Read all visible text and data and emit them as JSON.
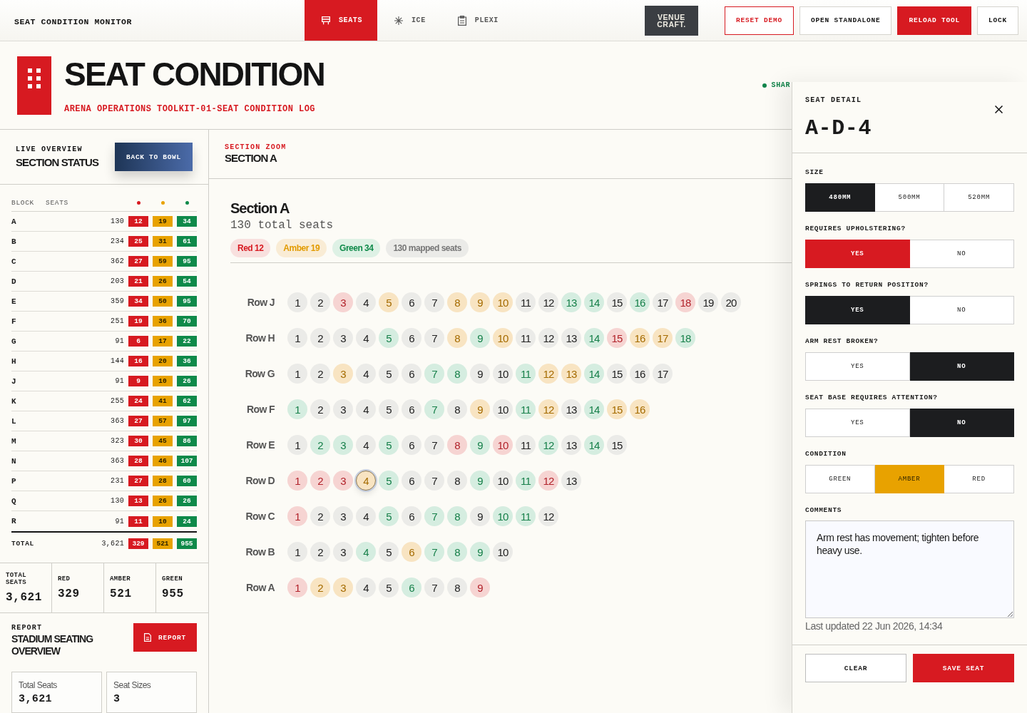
{
  "app": {
    "title": "SEAT CONDITION MONITOR"
  },
  "tabs": [
    {
      "label": "SEATS",
      "selected": true
    },
    {
      "label": "ICE",
      "selected": false
    },
    {
      "label": "PLEXI",
      "selected": false
    }
  ],
  "logo": {
    "lines": [
      "VENUE",
      "CRAFT."
    ]
  },
  "actions": [
    {
      "label": "RESET DEMO",
      "kind": "warning"
    },
    {
      "label": "OPEN STANDALONE",
      "kind": "plain"
    },
    {
      "label": "RELOAD TOOL",
      "kind": "primary"
    },
    {
      "label": "LOCK",
      "kind": "plain"
    }
  ],
  "header": {
    "title": "SEAT CONDITION",
    "subtitle": "ARENA OPERATIONS TOOLKIT-01-SEAT CONDITION LOG",
    "share_status": "SHAR"
  },
  "sidebar": {
    "overview": {
      "eyebrow": "LIVE OVERVIEW",
      "title": "SECTION STATUS",
      "button": "BACK TO BOWL"
    },
    "table": {
      "columns": [
        "BLOCK",
        "SEATS"
      ],
      "status_columns": [
        {
          "color": "#d71a21"
        },
        {
          "color": "#e8a200"
        },
        {
          "color": "#0f8a4a"
        }
      ],
      "rows": [
        {
          "block": "A",
          "seats": "130",
          "counts": [
            "12",
            "19",
            "34"
          ]
        },
        {
          "block": "B",
          "seats": "234",
          "counts": [
            "25",
            "31",
            "61"
          ]
        },
        {
          "block": "C",
          "seats": "362",
          "counts": [
            "27",
            "59",
            "95"
          ]
        },
        {
          "block": "D",
          "seats": "203",
          "counts": [
            "21",
            "26",
            "54"
          ]
        },
        {
          "block": "E",
          "seats": "359",
          "counts": [
            "34",
            "50",
            "95"
          ]
        },
        {
          "block": "F",
          "seats": "251",
          "counts": [
            "19",
            "36",
            "70"
          ]
        },
        {
          "block": "G",
          "seats": "91",
          "counts": [
            "6",
            "17",
            "22"
          ]
        },
        {
          "block": "H",
          "seats": "144",
          "counts": [
            "16",
            "20",
            "36"
          ]
        },
        {
          "block": "J",
          "seats": "91",
          "counts": [
            "9",
            "10",
            "26"
          ]
        },
        {
          "block": "K",
          "seats": "255",
          "counts": [
            "24",
            "41",
            "62"
          ]
        },
        {
          "block": "L",
          "seats": "363",
          "counts": [
            "27",
            "57",
            "97"
          ]
        },
        {
          "block": "M",
          "seats": "323",
          "counts": [
            "30",
            "45",
            "86"
          ]
        },
        {
          "block": "N",
          "seats": "363",
          "counts": [
            "28",
            "46",
            "107"
          ]
        },
        {
          "block": "P",
          "seats": "231",
          "counts": [
            "27",
            "28",
            "60"
          ]
        },
        {
          "block": "Q",
          "seats": "130",
          "counts": [
            "13",
            "26",
            "26"
          ]
        },
        {
          "block": "R",
          "seats": "91",
          "counts": [
            "11",
            "10",
            "24"
          ]
        }
      ],
      "total": {
        "label": "TOTAL",
        "seats": "3,621",
        "counts": [
          "329",
          "521",
          "955"
        ]
      }
    },
    "stats": [
      {
        "label": "TOTAL SEATS",
        "value": "3,621"
      },
      {
        "label": "RED",
        "value": "329"
      },
      {
        "label": "AMBER",
        "value": "521"
      },
      {
        "label": "GREEN",
        "value": "955"
      }
    ],
    "report": {
      "eyebrow": "REPORT",
      "title": "STADIUM SEATING OVERVIEW",
      "button": "REPORT",
      "cards": [
        {
          "label": "Total Seats",
          "value": "3,621"
        },
        {
          "label": "Seat Sizes",
          "value": "3"
        }
      ]
    }
  },
  "section": {
    "eyebrow": "SECTION ZOOM",
    "heading": "SECTION A",
    "name": "Section A",
    "total": "130 total seats",
    "pills": [
      {
        "label": "Red 12",
        "kind": "red"
      },
      {
        "label": "Amber 19",
        "kind": "amber"
      },
      {
        "label": "Green 34",
        "kind": "green"
      },
      {
        "label": "130 mapped seats",
        "kind": "neutral"
      }
    ],
    "rows": [
      {
        "label": "Row J",
        "seats": [
          {
            "label": "1",
            "kind": "none",
            "selected": false
          },
          {
            "label": "2",
            "kind": "none",
            "selected": false
          },
          {
            "label": "3",
            "kind": "red",
            "selected": false
          },
          {
            "label": "4",
            "kind": "none",
            "selected": false
          },
          {
            "label": "5",
            "kind": "amber",
            "selected": false
          },
          {
            "label": "6",
            "kind": "none",
            "selected": false
          },
          {
            "label": "7",
            "kind": "none",
            "selected": false
          },
          {
            "label": "8",
            "kind": "amber",
            "selected": false
          },
          {
            "label": "9",
            "kind": "amber",
            "selected": false
          },
          {
            "label": "10",
            "kind": "amber",
            "selected": false
          },
          {
            "label": "11",
            "kind": "none",
            "selected": false
          },
          {
            "label": "12",
            "kind": "none",
            "selected": false
          },
          {
            "label": "13",
            "kind": "green",
            "selected": false
          },
          {
            "label": "14",
            "kind": "green",
            "selected": false
          },
          {
            "label": "15",
            "kind": "none",
            "selected": false
          },
          {
            "label": "16",
            "kind": "green",
            "selected": false
          },
          {
            "label": "17",
            "kind": "none",
            "selected": false
          },
          {
            "label": "18",
            "kind": "red",
            "selected": false
          },
          {
            "label": "19",
            "kind": "none",
            "selected": false
          },
          {
            "label": "20",
            "kind": "none",
            "selected": false
          }
        ]
      },
      {
        "label": "Row H",
        "seats": [
          {
            "label": "1",
            "kind": "none",
            "selected": false
          },
          {
            "label": "2",
            "kind": "none",
            "selected": false
          },
          {
            "label": "3",
            "kind": "none",
            "selected": false
          },
          {
            "label": "4",
            "kind": "none",
            "selected": false
          },
          {
            "label": "5",
            "kind": "green",
            "selected": false
          },
          {
            "label": "6",
            "kind": "none",
            "selected": false
          },
          {
            "label": "7",
            "kind": "none",
            "selected": false
          },
          {
            "label": "8",
            "kind": "amber",
            "selected": false
          },
          {
            "label": "9",
            "kind": "green",
            "selected": false
          },
          {
            "label": "10",
            "kind": "amber",
            "selected": false
          },
          {
            "label": "11",
            "kind": "none",
            "selected": false
          },
          {
            "label": "12",
            "kind": "none",
            "selected": false
          },
          {
            "label": "13",
            "kind": "none",
            "selected": false
          },
          {
            "label": "14",
            "kind": "green",
            "selected": false
          },
          {
            "label": "15",
            "kind": "red",
            "selected": false
          },
          {
            "label": "16",
            "kind": "amber",
            "selected": false
          },
          {
            "label": "17",
            "kind": "amber",
            "selected": false
          },
          {
            "label": "18",
            "kind": "green",
            "selected": false
          }
        ]
      },
      {
        "label": "Row G",
        "seats": [
          {
            "label": "1",
            "kind": "none",
            "selected": false
          },
          {
            "label": "2",
            "kind": "none",
            "selected": false
          },
          {
            "label": "3",
            "kind": "amber",
            "selected": false
          },
          {
            "label": "4",
            "kind": "none",
            "selected": false
          },
          {
            "label": "5",
            "kind": "none",
            "selected": false
          },
          {
            "label": "6",
            "kind": "none",
            "selected": false
          },
          {
            "label": "7",
            "kind": "green",
            "selected": false
          },
          {
            "label": "8",
            "kind": "green",
            "selected": false
          },
          {
            "label": "9",
            "kind": "none",
            "selected": false
          },
          {
            "label": "10",
            "kind": "none",
            "selected": false
          },
          {
            "label": "11",
            "kind": "green",
            "selected": false
          },
          {
            "label": "12",
            "kind": "amber",
            "selected": false
          },
          {
            "label": "13",
            "kind": "amber",
            "selected": false
          },
          {
            "label": "14",
            "kind": "green",
            "selected": false
          },
          {
            "label": "15",
            "kind": "none",
            "selected": false
          },
          {
            "label": "16",
            "kind": "none",
            "selected": false
          },
          {
            "label": "17",
            "kind": "none",
            "selected": false
          }
        ]
      },
      {
        "label": "Row F",
        "seats": [
          {
            "label": "1",
            "kind": "green",
            "selected": false
          },
          {
            "label": "2",
            "kind": "none",
            "selected": false
          },
          {
            "label": "3",
            "kind": "none",
            "selected": false
          },
          {
            "label": "4",
            "kind": "none",
            "selected": false
          },
          {
            "label": "5",
            "kind": "none",
            "selected": false
          },
          {
            "label": "6",
            "kind": "none",
            "selected": false
          },
          {
            "label": "7",
            "kind": "green",
            "selected": false
          },
          {
            "label": "8",
            "kind": "none",
            "selected": false
          },
          {
            "label": "9",
            "kind": "amber",
            "selected": false
          },
          {
            "label": "10",
            "kind": "none",
            "selected": false
          },
          {
            "label": "11",
            "kind": "green",
            "selected": false
          },
          {
            "label": "12",
            "kind": "amber",
            "selected": false
          },
          {
            "label": "13",
            "kind": "none",
            "selected": false
          },
          {
            "label": "14",
            "kind": "green",
            "selected": false
          },
          {
            "label": "15",
            "kind": "amber",
            "selected": false
          },
          {
            "label": "16",
            "kind": "amber",
            "selected": false
          }
        ]
      },
      {
        "label": "Row E",
        "seats": [
          {
            "label": "1",
            "kind": "none",
            "selected": false
          },
          {
            "label": "2",
            "kind": "green",
            "selected": false
          },
          {
            "label": "3",
            "kind": "green",
            "selected": false
          },
          {
            "label": "4",
            "kind": "none",
            "selected": false
          },
          {
            "label": "5",
            "kind": "green",
            "selected": false
          },
          {
            "label": "6",
            "kind": "none",
            "selected": false
          },
          {
            "label": "7",
            "kind": "none",
            "selected": false
          },
          {
            "label": "8",
            "kind": "red",
            "selected": false
          },
          {
            "label": "9",
            "kind": "green",
            "selected": false
          },
          {
            "label": "10",
            "kind": "red",
            "selected": false
          },
          {
            "label": "11",
            "kind": "none",
            "selected": false
          },
          {
            "label": "12",
            "kind": "green",
            "selected": false
          },
          {
            "label": "13",
            "kind": "none",
            "selected": false
          },
          {
            "label": "14",
            "kind": "green",
            "selected": false
          },
          {
            "label": "15",
            "kind": "none",
            "selected": false
          }
        ]
      },
      {
        "label": "Row D",
        "seats": [
          {
            "label": "1",
            "kind": "red",
            "selected": false
          },
          {
            "label": "2",
            "kind": "red",
            "selected": false
          },
          {
            "label": "3",
            "kind": "red",
            "selected": false
          },
          {
            "label": "4",
            "kind": "amber",
            "selected": true
          },
          {
            "label": "5",
            "kind": "green",
            "selected": false
          },
          {
            "label": "6",
            "kind": "none",
            "selected": false
          },
          {
            "label": "7",
            "kind": "none",
            "selected": false
          },
          {
            "label": "8",
            "kind": "none",
            "selected": false
          },
          {
            "label": "9",
            "kind": "green",
            "selected": false
          },
          {
            "label": "10",
            "kind": "none",
            "selected": false
          },
          {
            "label": "11",
            "kind": "green",
            "selected": false
          },
          {
            "label": "12",
            "kind": "red",
            "selected": false
          },
          {
            "label": "13",
            "kind": "none",
            "selected": false
          }
        ]
      },
      {
        "label": "Row C",
        "seats": [
          {
            "label": "1",
            "kind": "red",
            "selected": false
          },
          {
            "label": "2",
            "kind": "none",
            "selected": false
          },
          {
            "label": "3",
            "kind": "none",
            "selected": false
          },
          {
            "label": "4",
            "kind": "none",
            "selected": false
          },
          {
            "label": "5",
            "kind": "green",
            "selected": false
          },
          {
            "label": "6",
            "kind": "none",
            "selected": false
          },
          {
            "label": "7",
            "kind": "green",
            "selected": false
          },
          {
            "label": "8",
            "kind": "green",
            "selected": false
          },
          {
            "label": "9",
            "kind": "none",
            "selected": false
          },
          {
            "label": "10",
            "kind": "green",
            "selected": false
          },
          {
            "label": "11",
            "kind": "green",
            "selected": false
          },
          {
            "label": "12",
            "kind": "none",
            "selected": false
          }
        ]
      },
      {
        "label": "Row B",
        "seats": [
          {
            "label": "1",
            "kind": "none",
            "selected": false
          },
          {
            "label": "2",
            "kind": "none",
            "selected": false
          },
          {
            "label": "3",
            "kind": "none",
            "selected": false
          },
          {
            "label": "4",
            "kind": "green",
            "selected": false
          },
          {
            "label": "5",
            "kind": "none",
            "selected": false
          },
          {
            "label": "6",
            "kind": "amber",
            "selected": false
          },
          {
            "label": "7",
            "kind": "green",
            "selected": false
          },
          {
            "label": "8",
            "kind": "green",
            "selected": false
          },
          {
            "label": "9",
            "kind": "green",
            "selected": false
          },
          {
            "label": "10",
            "kind": "none",
            "selected": false
          }
        ]
      },
      {
        "label": "Row A",
        "seats": [
          {
            "label": "1",
            "kind": "red",
            "selected": false
          },
          {
            "label": "2",
            "kind": "amber",
            "selected": false
          },
          {
            "label": "3",
            "kind": "amber",
            "selected": false
          },
          {
            "label": "4",
            "kind": "none",
            "selected": false
          },
          {
            "label": "5",
            "kind": "none",
            "selected": false
          },
          {
            "label": "6",
            "kind": "green",
            "selected": false
          },
          {
            "label": "7",
            "kind": "none",
            "selected": false
          },
          {
            "label": "8",
            "kind": "none",
            "selected": false
          },
          {
            "label": "9",
            "kind": "red",
            "selected": false
          }
        ]
      }
    ]
  },
  "detail": {
    "eyebrow": "SEAT DETAIL",
    "seat_id": "A-D-4",
    "fields": [
      {
        "label": "SIZE",
        "kind": "plain",
        "options": [
          {
            "label": "480MM",
            "selected": true
          },
          {
            "label": "500MM",
            "selected": false
          },
          {
            "label": "520MM",
            "selected": false
          }
        ]
      },
      {
        "label": "REQUIRES UPHOLSTERING?",
        "kind": "alert",
        "options": [
          {
            "label": "YES",
            "selected": true
          },
          {
            "label": "NO",
            "selected": false
          }
        ]
      },
      {
        "label": "SPRINGS TO RETURN POSITION?",
        "kind": "plain",
        "options": [
          {
            "label": "YES",
            "selected": true
          },
          {
            "label": "NO",
            "selected": false
          }
        ]
      },
      {
        "label": "ARM REST BROKEN?",
        "kind": "plain",
        "options": [
          {
            "label": "YES",
            "selected": false
          },
          {
            "label": "NO",
            "selected": true
          }
        ]
      },
      {
        "label": "SEAT BASE REQUIRES ATTENTION?",
        "kind": "plain",
        "options": [
          {
            "label": "YES",
            "selected": false
          },
          {
            "label": "NO",
            "selected": true
          }
        ]
      },
      {
        "label": "CONDITION",
        "kind": "condition",
        "options": [
          {
            "label": "GREEN",
            "selected": false
          },
          {
            "label": "AMBER",
            "selected": true
          },
          {
            "label": "RED",
            "selected": false
          }
        ]
      }
    ],
    "comments": {
      "label": "COMMENTS",
      "value": "Arm rest has movement; tighten before heavy use."
    },
    "updated": "Last updated 22 Jun 2026, 14:34",
    "buttons": [
      {
        "label": "CLEAR",
        "kind": "plain"
      },
      {
        "label": "SAVE SEAT",
        "kind": "primary"
      }
    ]
  }
}
